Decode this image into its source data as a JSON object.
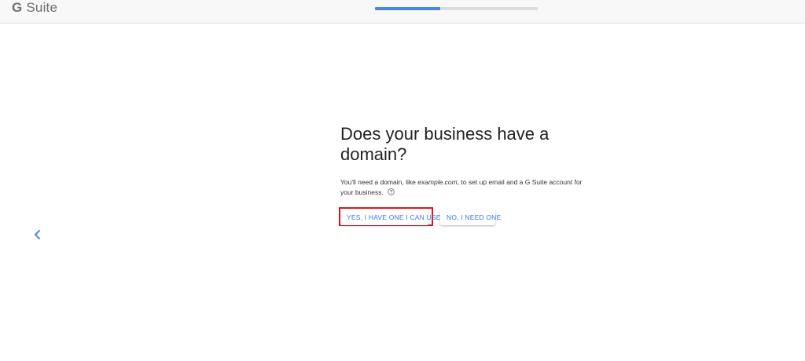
{
  "header": {
    "logo_g": "G",
    "logo_text": "Suite",
    "progress_fraction": 0.4
  },
  "main": {
    "title": "Does your business have a domain?",
    "desc_before": "You'll need a domain, like ",
    "desc_example": "example.com",
    "desc_after": ", to set up email and a G Suite account for your business.",
    "yes_label": "YES, I HAVE ONE I CAN USE",
    "no_label": "NO, I NEED ONE"
  },
  "colors": {
    "accent": "#4a86e8",
    "button_text": "#3b78e7",
    "highlight": "#e0151b"
  },
  "icons": {
    "back": "chevron-left-icon",
    "help": "help-circle-icon"
  }
}
